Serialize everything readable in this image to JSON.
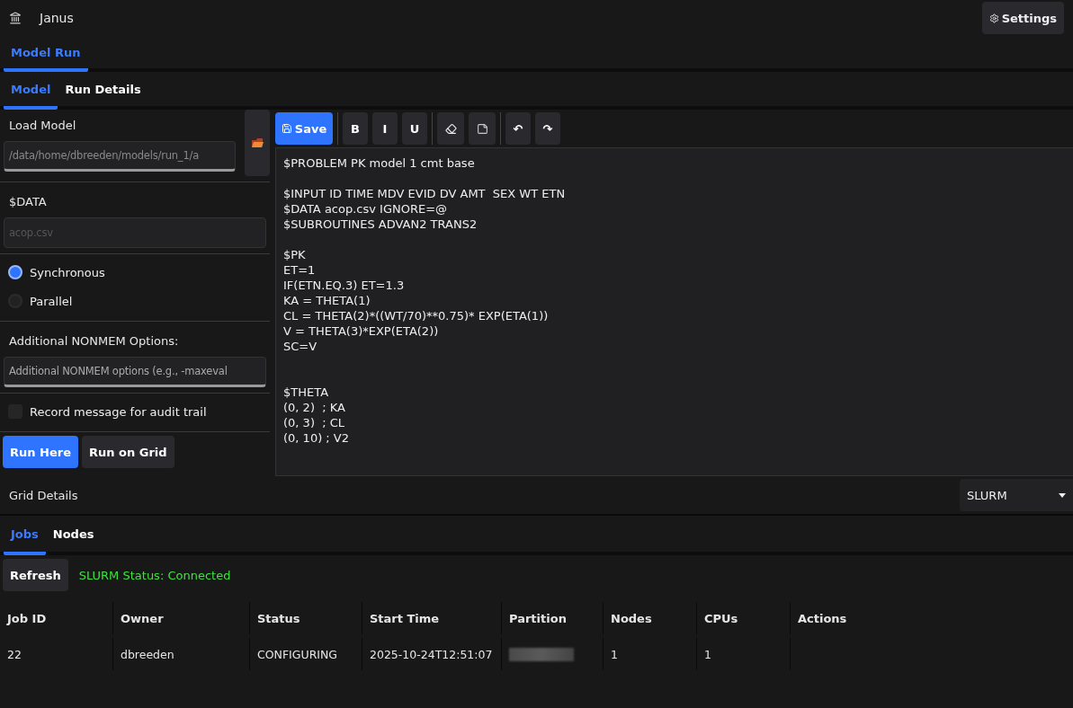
{
  "app": {
    "title": "Janus",
    "settings_label": "Settings"
  },
  "main_tabs": [
    {
      "label": "Model Run",
      "selected": true
    }
  ],
  "sub_tabs": [
    {
      "label": "Model",
      "selected": true
    },
    {
      "label": "Run Details",
      "selected": false
    }
  ],
  "left_panel": {
    "load_model_label": "Load Model",
    "model_path": "/data/home/dbreeden/models/run_1/a",
    "data_label": "$DATA",
    "data_placeholder": "acop.csv",
    "run_modes": [
      {
        "label": "Synchronous",
        "selected": true
      },
      {
        "label": "Parallel",
        "selected": false
      }
    ],
    "options_label": "Additional NONMEM Options:",
    "options_placeholder": "Additional NONMEM options (e.g., -maxeval",
    "audit": {
      "label": "Record message for audit trail",
      "checked": false
    },
    "buttons": [
      {
        "label": "Run Here",
        "kind": "primary"
      },
      {
        "label": "Run on Grid",
        "kind": "secondary"
      }
    ]
  },
  "editor": {
    "save_label": "Save",
    "format_buttons": [
      "B",
      "I",
      "U"
    ],
    "undo_label": "↶",
    "redo_label": "↷",
    "text": "$PROBLEM PK model 1 cmt base\n\n$INPUT ID TIME MDV EVID DV AMT  SEX WT ETN\n$DATA acop.csv IGNORE=@\n$SUBROUTINES ADVAN2 TRANS2\n\n$PK\nET=1\nIF(ETN.EQ.3) ET=1.3\nKA = THETA(1)\nCL = THETA(2)*((WT/70)**0.75)* EXP(ETA(1))\nV = THETA(3)*EXP(ETA(2))\nSC=V\n\n\n$THETA\n(0, 2)  ; KA\n(0, 3)  ; CL\n(0, 10) ; V2"
  },
  "grid": {
    "label": "Grid Details",
    "scheduler": "SLURM",
    "tabs": [
      {
        "label": "Jobs",
        "selected": true
      },
      {
        "label": "Nodes",
        "selected": false
      }
    ],
    "refresh_label": "Refresh",
    "status": "SLURM Status: Connected",
    "table": {
      "columns": [
        "Job ID",
        "Owner",
        "Status",
        "Start Time",
        "Partition",
        "Nodes",
        "CPUs",
        "Actions"
      ],
      "rows": [
        {
          "cells": [
            "22",
            "dbreeden",
            "CONFIGURING",
            "2025-10-24T12:51:07",
            {
              "kind": "redacted"
            },
            "1",
            "1",
            ""
          ]
        }
      ]
    }
  }
}
